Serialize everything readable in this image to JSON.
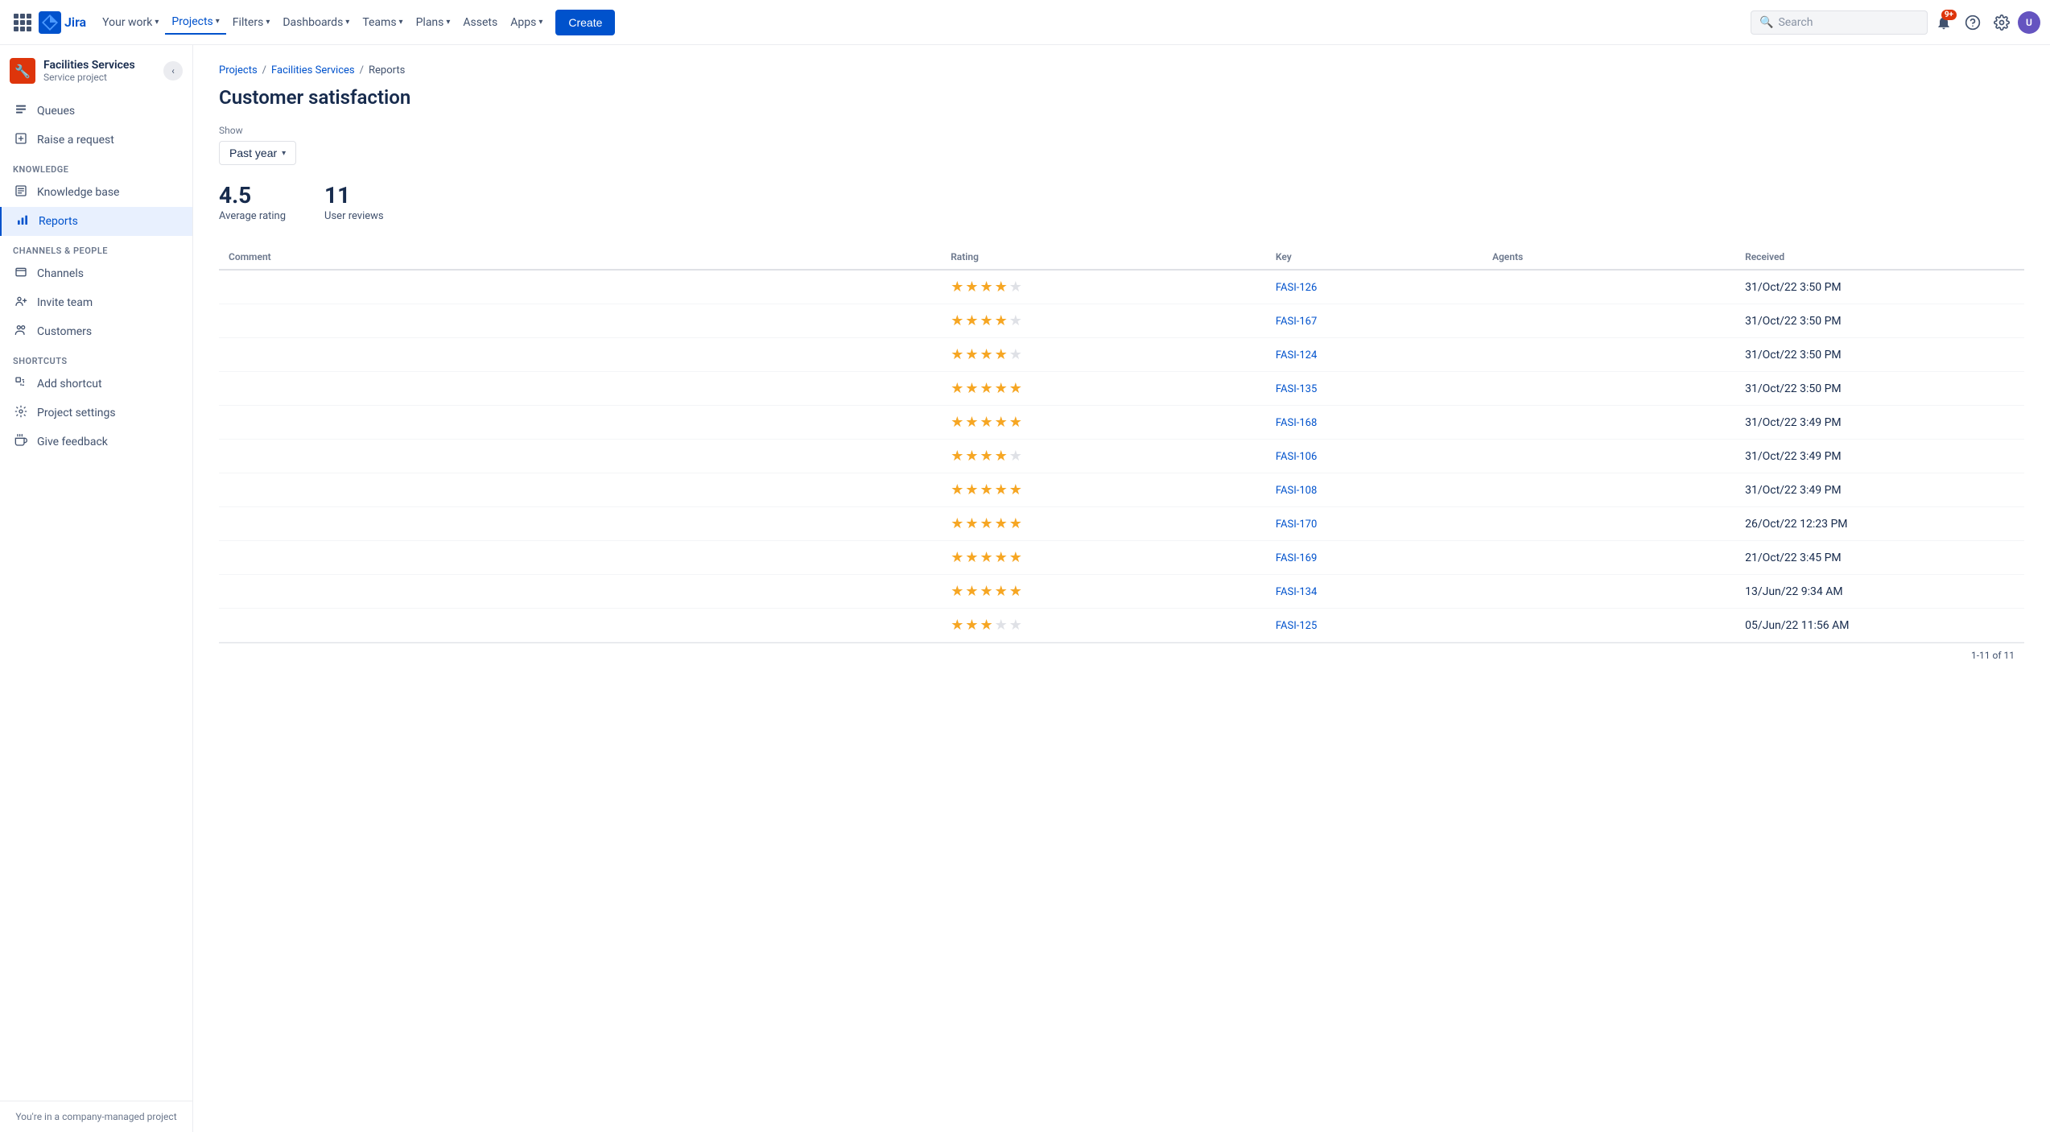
{
  "topnav": {
    "logo_text": "Jira",
    "items": [
      {
        "label": "Your work",
        "has_chevron": true,
        "active": false
      },
      {
        "label": "Projects",
        "has_chevron": true,
        "active": true
      },
      {
        "label": "Filters",
        "has_chevron": true,
        "active": false
      },
      {
        "label": "Dashboards",
        "has_chevron": true,
        "active": false
      },
      {
        "label": "Teams",
        "has_chevron": true,
        "active": false
      },
      {
        "label": "Plans",
        "has_chevron": true,
        "active": false
      },
      {
        "label": "Assets",
        "has_chevron": false,
        "active": false
      },
      {
        "label": "Apps",
        "has_chevron": true,
        "active": false
      }
    ],
    "create_label": "Create",
    "search_placeholder": "Search",
    "notification_count": "9+"
  },
  "sidebar": {
    "project_name": "Facilities Services",
    "project_type": "Service project",
    "nav_items": [
      {
        "label": "Queues",
        "icon": "queues",
        "active": false,
        "section": null
      },
      {
        "label": "Raise a request",
        "icon": "raise",
        "active": false,
        "section": null
      },
      {
        "label": "Knowledge base",
        "icon": "kb",
        "active": false,
        "section": "KNOWLEDGE"
      },
      {
        "label": "Reports",
        "icon": "reports",
        "active": true,
        "section": null
      },
      {
        "label": "Channels",
        "icon": "channels",
        "active": false,
        "section": "CHANNELS & PEOPLE"
      },
      {
        "label": "Invite team",
        "icon": "invite",
        "active": false,
        "section": null
      },
      {
        "label": "Customers",
        "icon": "customers",
        "active": false,
        "section": null
      },
      {
        "label": "Add shortcut",
        "icon": "shortcut",
        "active": false,
        "section": "SHORTCUTS"
      },
      {
        "label": "Project settings",
        "icon": "settings",
        "active": false,
        "section": null
      },
      {
        "label": "Give feedback",
        "icon": "feedback",
        "active": false,
        "section": null
      }
    ],
    "footer_text": "You're in a company-managed project"
  },
  "breadcrumb": {
    "items": [
      "Projects",
      "Facilities Services",
      "Reports"
    ]
  },
  "page": {
    "title": "Customer satisfaction",
    "show_label": "Show",
    "show_value": "Past year",
    "avg_rating": "4.5",
    "avg_rating_label": "Average rating",
    "user_reviews": "11",
    "user_reviews_label": "User reviews"
  },
  "table": {
    "headers": [
      "Comment",
      "Rating",
      "Key",
      "Agents",
      "Received"
    ],
    "rows": [
      {
        "comment": "",
        "rating": 4,
        "key": "FASI-126",
        "agents": "",
        "received": "31/Oct/22 3:50 PM"
      },
      {
        "comment": "",
        "rating": 4,
        "key": "FASI-167",
        "agents": "",
        "received": "31/Oct/22 3:50 PM"
      },
      {
        "comment": "",
        "rating": 4,
        "key": "FASI-124",
        "agents": "",
        "received": "31/Oct/22 3:50 PM"
      },
      {
        "comment": "",
        "rating": 5,
        "key": "FASI-135",
        "agents": "",
        "received": "31/Oct/22 3:50 PM"
      },
      {
        "comment": "",
        "rating": 5,
        "key": "FASI-168",
        "agents": "",
        "received": "31/Oct/22 3:49 PM"
      },
      {
        "comment": "",
        "rating": 4,
        "key": "FASI-106",
        "agents": "",
        "received": "31/Oct/22 3:49 PM"
      },
      {
        "comment": "",
        "rating": 5,
        "key": "FASI-108",
        "agents": "",
        "received": "31/Oct/22 3:49 PM"
      },
      {
        "comment": "",
        "rating": 5,
        "key": "FASI-170",
        "agents": "",
        "received": "26/Oct/22 12:23 PM"
      },
      {
        "comment": "",
        "rating": 5,
        "key": "FASI-169",
        "agents": "",
        "received": "21/Oct/22 3:45 PM"
      },
      {
        "comment": "",
        "rating": 5,
        "key": "FASI-134",
        "agents": "",
        "received": "13/Jun/22 9:34 AM"
      },
      {
        "comment": "",
        "rating": 3,
        "key": "FASI-125",
        "agents": "",
        "received": "05/Jun/22 11:56 AM"
      }
    ],
    "pagination": "1-11 of 11"
  }
}
